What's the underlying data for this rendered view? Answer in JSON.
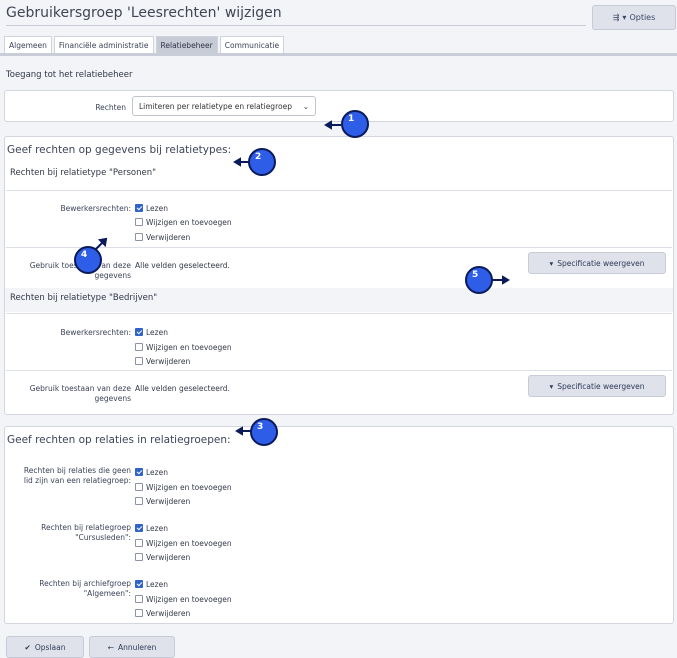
{
  "header": {
    "title": "Gebruikersgroep 'Leesrechten' wijzigen",
    "options_label": "Opties"
  },
  "tabs": [
    {
      "label": "Algemeen"
    },
    {
      "label": "Financiële administratie"
    },
    {
      "label": "Relatiebeheer",
      "active": true
    },
    {
      "label": "Communicatie"
    }
  ],
  "access": {
    "heading": "Toegang tot het relatiebeheer",
    "rights_label": "Rechten",
    "rights_value": "Limiteren per relatietype en relatiegroep"
  },
  "types_group": {
    "title": "Geef rechten op gegevens bij relatietypes:",
    "blocks": [
      {
        "title": "Rechten bij relatietype \"Personen\"",
        "edit_label": "Bewerkersrechten:",
        "opt_read": "Lezen",
        "opt_edit": "Wijzigen en toevoegen",
        "opt_delete": "Verwijderen",
        "use_label_1": "Gebruik toestaan van deze",
        "use_label_2": "gegevens",
        "use_value": "Alle velden geselecteerd.",
        "spec_button": "Specificatie weergeven"
      },
      {
        "title": "Rechten bij relatietype \"Bedrijven\"",
        "edit_label": "Bewerkersrechten:",
        "opt_read": "Lezen",
        "opt_edit": "Wijzigen en toevoegen",
        "opt_delete": "Verwijderen",
        "use_label_1": "Gebruik toestaan van deze",
        "use_label_2": "gegevens",
        "use_value": "Alle velden geselecteerd.",
        "spec_button": "Specificatie weergeven"
      }
    ]
  },
  "groups_group": {
    "title": "Geef rechten op relaties in relatiegroepen:",
    "rows": [
      {
        "label_1": "Rechten bij relaties die geen",
        "label_2": "lid zijn van een relatiegroep:",
        "opt_read": "Lezen",
        "opt_edit": "Wijzigen en toevoegen",
        "opt_delete": "Verwijderen"
      },
      {
        "label_1": "Rechten bij relatiegroep",
        "label_2": "\"Cursusleden\":",
        "opt_read": "Lezen",
        "opt_edit": "Wijzigen en toevoegen",
        "opt_delete": "Verwijderen"
      },
      {
        "label_1": "Rechten bij archiefgroep",
        "label_2": "\"Algemeen\":",
        "opt_read": "Lezen",
        "opt_edit": "Wijzigen en toevoegen",
        "opt_delete": "Verwijderen"
      }
    ]
  },
  "footer": {
    "save_label": "Opslaan",
    "cancel_label": "Annuleren"
  },
  "markers": [
    {
      "number": "1"
    },
    {
      "number": "2"
    },
    {
      "number": "3"
    },
    {
      "number": "4"
    },
    {
      "number": "5"
    }
  ],
  "colors": {
    "accent": "#2e63c9",
    "marker": "#2e5ee8",
    "button_bg": "#dfe2ea"
  }
}
